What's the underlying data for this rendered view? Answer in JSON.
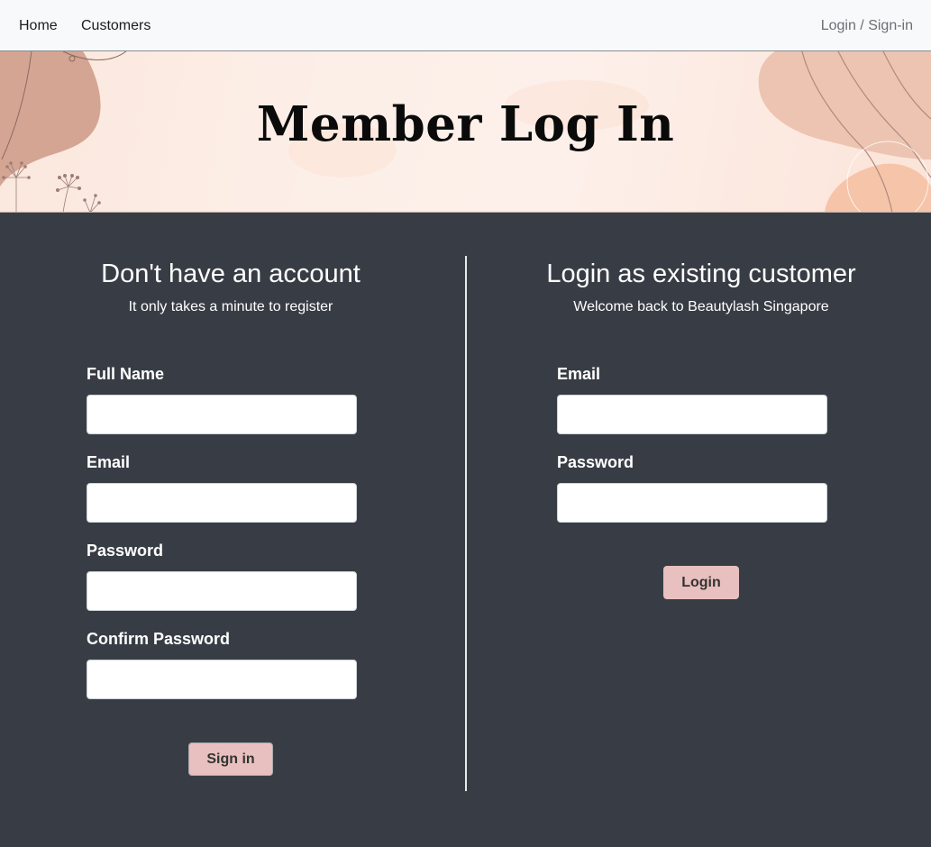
{
  "nav": {
    "home": "Home",
    "customers": "Customers",
    "login": "Login / Sign-in"
  },
  "hero": {
    "title": "Member Log In"
  },
  "register": {
    "title": "Don't have an account",
    "subtitle": "It only takes a minute to register",
    "full_name_label": "Full Name",
    "full_name_value": "",
    "email_label": "Email",
    "email_value": "",
    "password_label": "Password",
    "password_value": "",
    "confirm_label": "Confirm Password",
    "confirm_value": "",
    "submit_label": "Sign in"
  },
  "login": {
    "title": "Login as existing customer",
    "subtitle": "Welcome back to Beautylash Singapore",
    "email_label": "Email",
    "email_value": "",
    "password_label": "Password",
    "password_value": "",
    "submit_label": "Login"
  },
  "colors": {
    "background": "#383d45",
    "accent_button": "#e8c0bf",
    "navbar": "#f8f9fa"
  }
}
